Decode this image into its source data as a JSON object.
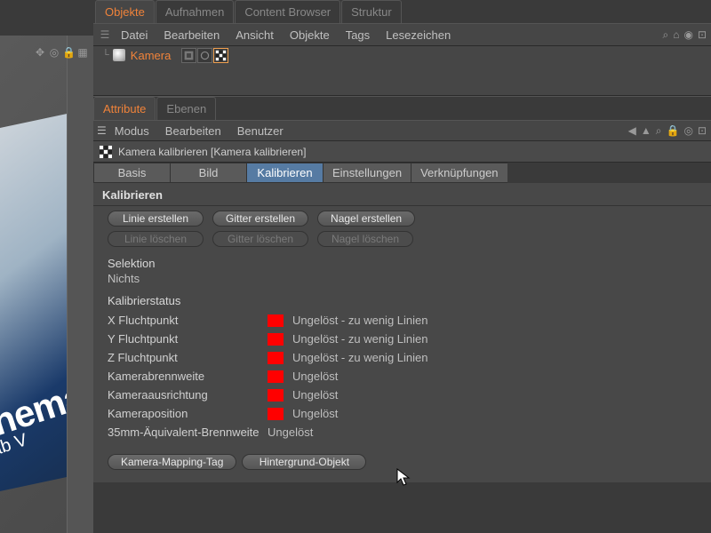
{
  "viewport": {
    "text1": "nemá",
    "text2": "ab V"
  },
  "topTabs": [
    "Objekte",
    "Aufnahmen",
    "Content Browser",
    "Struktur"
  ],
  "topTabActive": 0,
  "objectsMenu": [
    "Datei",
    "Bearbeiten",
    "Ansicht",
    "Objekte",
    "Tags",
    "Lesezeichen"
  ],
  "object": {
    "name": "Kamera"
  },
  "attrTabs": [
    "Attribute",
    "Ebenen"
  ],
  "attrTabActive": 0,
  "attrMenu": [
    "Modus",
    "Bearbeiten",
    "Benutzer"
  ],
  "attrHeader": "Kamera kalibrieren [Kamera kalibrieren]",
  "subTabs": [
    "Basis",
    "Bild",
    "Kalibrieren",
    "Einstellungen",
    "Verknüpfungen"
  ],
  "subTabActive": 2,
  "sectionTitle": "Kalibrieren",
  "createButtons": {
    "line": "Linie erstellen",
    "grid": "Gitter erstellen",
    "pin": "Nagel erstellen"
  },
  "deleteButtons": {
    "line": "Linie löschen",
    "grid": "Gitter löschen",
    "pin": "Nagel löschen"
  },
  "selection": {
    "label": "Selektion",
    "value": "Nichts"
  },
  "statusHeader": "Kalibrierstatus",
  "statusRows": [
    {
      "label": "X Fluchtpunkt",
      "color": "#ff0000",
      "value": "Ungelöst - zu wenig Linien"
    },
    {
      "label": "Y Fluchtpunkt",
      "color": "#ff0000",
      "value": "Ungelöst - zu wenig Linien"
    },
    {
      "label": "Z Fluchtpunkt",
      "color": "#ff0000",
      "value": "Ungelöst - zu wenig Linien"
    },
    {
      "label": "Kamerabrennweite",
      "color": "#ff0000",
      "value": "Ungelöst"
    },
    {
      "label": "Kameraausrichtung",
      "color": "#ff0000",
      "value": "Ungelöst"
    },
    {
      "label": "Kameraposition",
      "color": "#ff0000",
      "value": "Ungelöst"
    },
    {
      "label": "35mm-Äquivalent-Brennweite",
      "color": "",
      "value": "Ungelöst"
    }
  ],
  "bottomButtons": {
    "mapping": "Kamera-Mapping-Tag",
    "bg": "Hintergrund-Objekt"
  }
}
